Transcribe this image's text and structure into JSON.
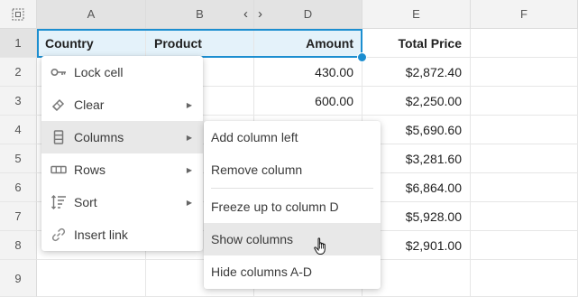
{
  "columns": [
    {
      "letter": "A"
    },
    {
      "letter": "B"
    },
    {
      "letter": "D"
    },
    {
      "letter": "E"
    },
    {
      "letter": "F"
    }
  ],
  "rows": [
    "1",
    "2",
    "3",
    "4",
    "5",
    "6",
    "7",
    "8",
    "9"
  ],
  "collapse_left_arrow": "‹",
  "collapse_right_arrow": "›",
  "cells": {
    "a1": "Country",
    "b1": "Product",
    "d1": "Amount",
    "e1": "Total Price",
    "d2": "430.00",
    "d3": "600.00",
    "e2": "$2,872.40",
    "e3": "$2,250.00",
    "e4": "$5,690.60",
    "e5": "$3,281.60",
    "e6": "$6,864.00",
    "e7": "$5,928.00",
    "e8": "$2,901.00"
  },
  "context_menu": {
    "items": [
      {
        "label": "Lock cell",
        "icon": "key-icon"
      },
      {
        "label": "Clear",
        "icon": "eraser-icon"
      },
      {
        "label": "Columns",
        "icon": "columns-icon"
      },
      {
        "label": "Rows",
        "icon": "rows-icon"
      },
      {
        "label": "Sort",
        "icon": "sort-icon"
      },
      {
        "label": "Insert link",
        "icon": "link-icon"
      }
    ],
    "submenu_arrow": "▶"
  },
  "columns_submenu": {
    "items": [
      "Add column left",
      "Remove column",
      "Freeze up to column D",
      "Show columns",
      "Hide columns A-D"
    ]
  },
  "colors": {
    "accent": "#1c8ed0",
    "selection_fill": "#e4f2fa",
    "header_bg": "#f3f3f3",
    "menu_hover": "#e8e8e8"
  }
}
